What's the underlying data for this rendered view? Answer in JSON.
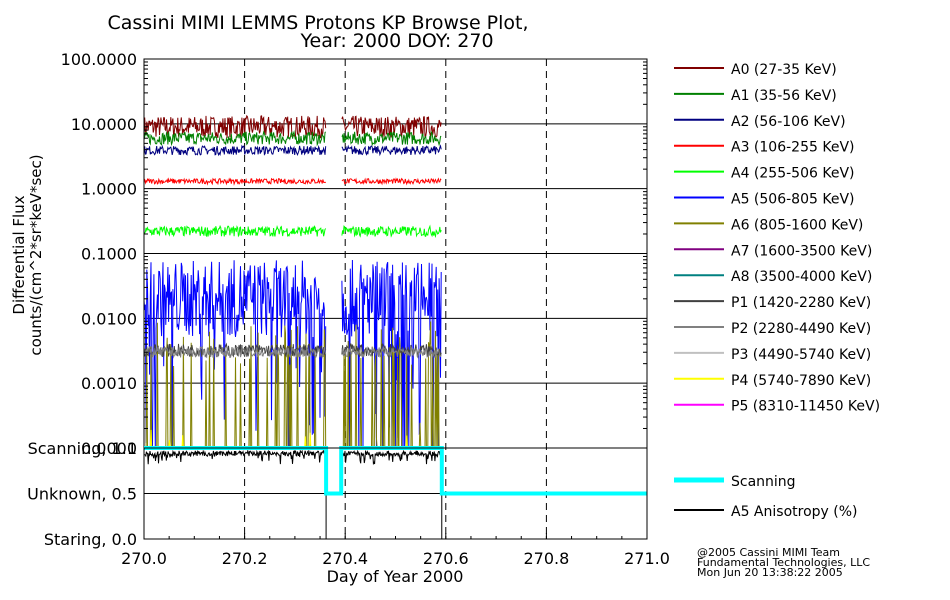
{
  "chart_data": [
    {
      "type": "line",
      "title_lines": [
        "Cassini MIMI LEMMS Protons KP Browse Plot,",
        "Year: 2000 DOY: 270"
      ],
      "ylabel_lines": [
        "Differential Flux",
        "counts/(cm^2*sr*keV*sec)"
      ],
      "yscale": "log",
      "ylim": [
        0.0001,
        100
      ],
      "yticks": [
        "100.0000",
        "10.0000",
        "1.0000",
        "0.1000",
        "0.0100",
        "0.0010",
        "0.0001"
      ],
      "xlim": [
        270.0,
        271.0
      ],
      "data_gaps": [
        [
          270.362,
          270.392
        ],
        [
          270.592,
          271.0
        ]
      ],
      "grid": true,
      "legend_position": "right",
      "series": [
        {
          "name": "A0 (27-35 KeV)",
          "color": "#800000",
          "level": 9.0,
          "noise": 0.17
        },
        {
          "name": "A1 (35-56 KeV)",
          "color": "#008000",
          "level": 6.0,
          "noise": 0.1
        },
        {
          "name": "A2 (56-106 KeV)",
          "color": "#000080",
          "level": 3.9,
          "noise": 0.07
        },
        {
          "name": "A3 (106-255 KeV)",
          "color": "#ff0000",
          "level": 1.3,
          "noise": 0.04
        },
        {
          "name": "A4 (255-506 KeV)",
          "color": "#00ff00",
          "level": 0.22,
          "noise": 0.08
        },
        {
          "name": "A5 (506-805 KeV)",
          "color": "#0000ff",
          "level": 0.02,
          "noise": 0.6
        },
        {
          "name": "A6 (805-1600 KeV)",
          "color": "#808000",
          "level": 0.004,
          "noise": 0.35
        },
        {
          "name": "A7 (1600-3500 KeV)",
          "color": "#800080",
          "level": null,
          "noise": 0
        },
        {
          "name": "A8 (3500-4000 KeV)",
          "color": "#008080",
          "level": null,
          "noise": 0
        },
        {
          "name": "P1 (1420-2280 KeV)",
          "color": "#404040",
          "level": 0.0032,
          "noise": 0.1
        },
        {
          "name": "P2 (2280-4490 KeV)",
          "color": "#808080",
          "level": 0.003,
          "noise": 0.08
        },
        {
          "name": "P3 (4490-5740 KeV)",
          "color": "#c0c0c0",
          "level": null,
          "noise": 0
        },
        {
          "name": "P4 (5740-7890 KeV)",
          "color": "#ffff00",
          "level": 0.00013,
          "noise": 0.2
        },
        {
          "name": "P5 (8310-11450 KeV)",
          "color": "#ff00ff",
          "level": null,
          "noise": 0
        }
      ]
    },
    {
      "type": "line",
      "ylim": [
        0.0,
        1.0
      ],
      "yticks": [
        "Scanning, 1.0",
        "Unknown, 0.5",
        "Staring, 0.0"
      ],
      "xlim": [
        270.0,
        271.0
      ],
      "xticks": [
        "270.0",
        "270.2",
        "270.4",
        "270.6",
        "270.8",
        "271.0"
      ],
      "xlabel": "Day of Year 2000",
      "legend_position": "right",
      "series": [
        {
          "name": "Scanning",
          "color": "#00ffff",
          "x": [
            270.0,
            270.362,
            270.362,
            270.38,
            270.38,
            270.392,
            270.392,
            270.592,
            270.592,
            271.0
          ],
          "y": [
            1.0,
            1.0,
            0.5,
            0.5,
            0.5,
            0.5,
            1.0,
            1.0,
            0.5,
            0.5
          ]
        },
        {
          "name": "A5 Anisotropy (%)",
          "color": "#000000"
        }
      ]
    }
  ],
  "footer_lines": [
    "@2005 Cassini MIMI Team",
    "Fundamental Technologies, LLC",
    "Mon Jun 20 13:38:22 2005"
  ]
}
